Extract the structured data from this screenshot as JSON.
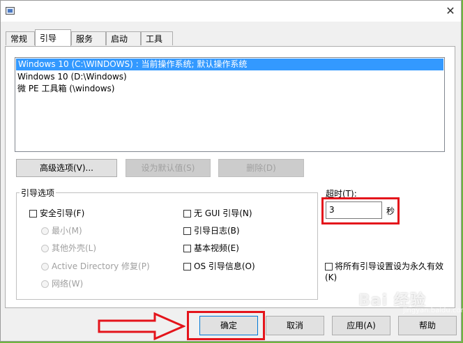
{
  "tabs": [
    "常规",
    "引导",
    "服务",
    "启动",
    "工具"
  ],
  "boot_entries": [
    "Windows 10 (C:\\WINDOWS) : 当前操作系统; 默认操作系统",
    "Windows 10 (D:\\Windows)",
    "微 PE 工具箱 (\\windows)"
  ],
  "buttons": {
    "advanced": "高级选项(V)...",
    "set_default": "设为默认值(S)",
    "delete": "删除(D)",
    "ok": "确定",
    "cancel": "取消",
    "apply": "应用(A)",
    "help": "帮助"
  },
  "boot_options": {
    "title": "引导选项",
    "safe_boot": "安全引导(F)",
    "minimal": "最小(M)",
    "alternate_shell": "其他外壳(L)",
    "active_directory": "Active Directory 修复(P)",
    "network": "网络(W)",
    "no_gui": "无 GUI 引导(N)",
    "boot_log": "引导日志(B)",
    "base_video": "基本视频(E)",
    "os_info": "OS 引导信息(O)"
  },
  "timeout": {
    "label": "超时(T):",
    "value": "3",
    "unit": "秒"
  },
  "permanent": "将所有引导设置设为永久有效(K)",
  "close_glyph": "✕",
  "watermark": "Bai 经验",
  "watermark_sub": "jingyan.baidu.com",
  "colors": {
    "highlight": "#e4141b",
    "selection": "#3399ff"
  }
}
